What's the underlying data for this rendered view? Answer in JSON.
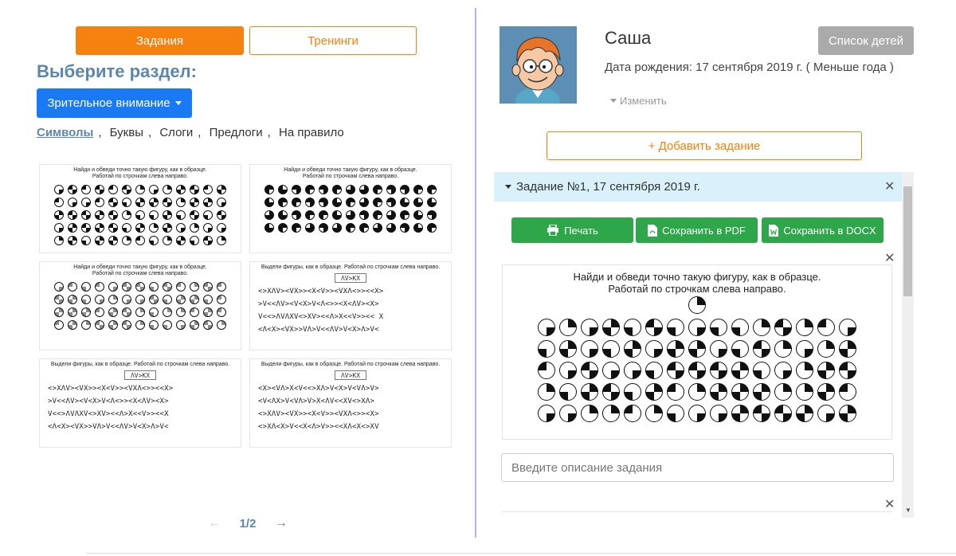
{
  "tabs": {
    "tasks": "Задания",
    "trainings": "Тренинги"
  },
  "section": {
    "title": "Выберите раздел:",
    "dropdown_label": "Зрительное внимание"
  },
  "categories": [
    "Символы",
    "Буквы",
    "Слоги",
    "Предлоги",
    "На правило"
  ],
  "thumbnails": [
    {
      "title": "Найди и обведи точно такую фигуру, как в образце.\nРаботай по строчкам слева направо."
    },
    {
      "title": "Найди и обведи точно такую фигуру, как в образце.\nРаботай по строчкам слева направо."
    },
    {
      "title": "Найди и обведи точно такую фигуру, как в образце.\nРаботай по строчкам слева направо."
    },
    {
      "title": "Выдели фигуры, как в образце. Работай по строчкам слева направо.",
      "sample": "ΛV>ΚX",
      "rows": [
        "<>XΛV><VX>><X<V>><VXΛ<>><<X>",
        ">V<<ΛV><V<X>V<Λ<>><X<ΛV><X>",
        "V<<>ΛVΛXV<>XV><<Λ>X<<V>><< X",
        "<Λ<X><VX>>VΛ>V<<ΛV>V<X>Λ>V<"
      ]
    },
    {
      "title": "Выдели фигуры, как в образце. Работай по строчкам слева направо.",
      "sample": "ΛV>ΚX",
      "rows": [
        "<>XΛV><VX>><X<V>><VXΛ<>><<X>",
        ">V<<ΛV><V<X>V<Λ<>><X<ΛV><X>",
        "V<<>ΛVΛXV<>XV><<Λ>X<<V>><<X",
        "<Λ<X><VX>>VΛ>V<<ΛV>V<X>Λ>V<"
      ]
    },
    {
      "title": "Выдели фигуры, как в образце. Работай по строчкам слева направо.",
      "sample": "ΛV>ΚX",
      "rows": [
        "<X><VΛ>X<V<<>XΛ>V<X>V<VΛ>V>",
        "<V<ΛX>V<VΛ>V>X<ΛV<<XV<>XΛ>",
        "<>XΛV><VX>><X<V>><VXΛ<>><X>",
        "<>XΛ<X>V<<X<Λ>V>><<XΛ<X<>XV"
      ]
    }
  ],
  "pagination": {
    "current": "1/2",
    "prev": "←",
    "next": "→"
  },
  "child": {
    "name": "Саша",
    "birth_label": "Дата рождения: 17 сентября 2019 г. ( Меньше года )",
    "edit_label": "Изменить",
    "children_list_button": "Список детей"
  },
  "add_task_label": "+ Добавить задание",
  "task": {
    "header": "Задание №1, 17 сентября 2019 г.",
    "print_label": "Печать",
    "pdf_label": "Сохранить в PDF",
    "docx_label": "Сохранить в DOCX",
    "worksheet_title": "Найди и обведи точно такую фигуру, как в образце.\nРаботай по строчкам слева направо.",
    "description_placeholder": "Введите описание задания"
  },
  "close_symbol": "✕",
  "colors": {
    "orange": "#f5810e",
    "blue": "#1a7af5",
    "title_blue": "#5b87ad",
    "green": "#2ea74a",
    "header_bg": "#d9f1fb",
    "gray_button": "#aaaaaa"
  },
  "icons": [
    "caret-down-icon",
    "printer-icon",
    "pdf-file-icon",
    "docx-file-icon",
    "close-icon",
    "arrow-left-icon",
    "arrow-right-icon"
  ]
}
